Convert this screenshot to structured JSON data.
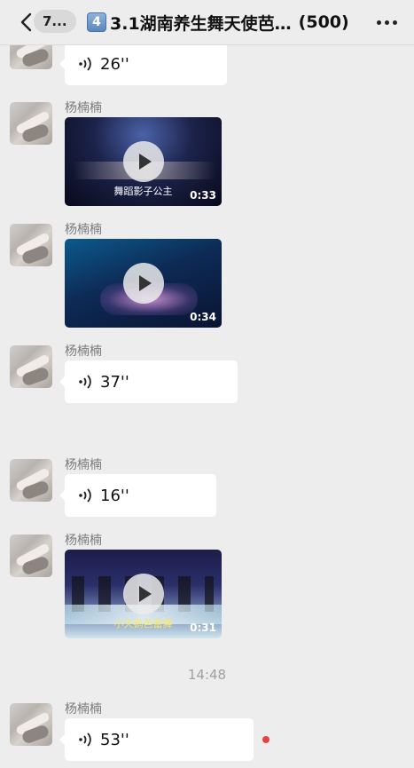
{
  "header": {
    "unread_count": "7...",
    "title_emoji": "4",
    "title": "3.1湖南养生舞天使芭…",
    "member_count": "(500)"
  },
  "messages": [
    {
      "type": "voice",
      "duration": "26''"
    },
    {
      "type": "video",
      "sender": "杨楠楠",
      "duration": "0:33",
      "caption": "舞蹈影子公主"
    },
    {
      "type": "video",
      "sender": "杨楠楠",
      "duration": "0:34",
      "caption": ""
    },
    {
      "type": "voice",
      "sender": "杨楠楠",
      "duration": "37''"
    },
    {
      "type": "voice",
      "sender": "杨楠楠",
      "duration": "16''"
    },
    {
      "type": "video",
      "sender": "杨楠楠",
      "duration": "0:31",
      "caption": "小天鹅芭蕾舞"
    },
    {
      "type": "voice",
      "sender": "杨楠楠",
      "duration": "53''",
      "unread": true
    }
  ],
  "time_separator": "14:48",
  "colors": {
    "background": "#ededed",
    "bubble": "#ffffff",
    "unread_dot": "#e64340"
  }
}
